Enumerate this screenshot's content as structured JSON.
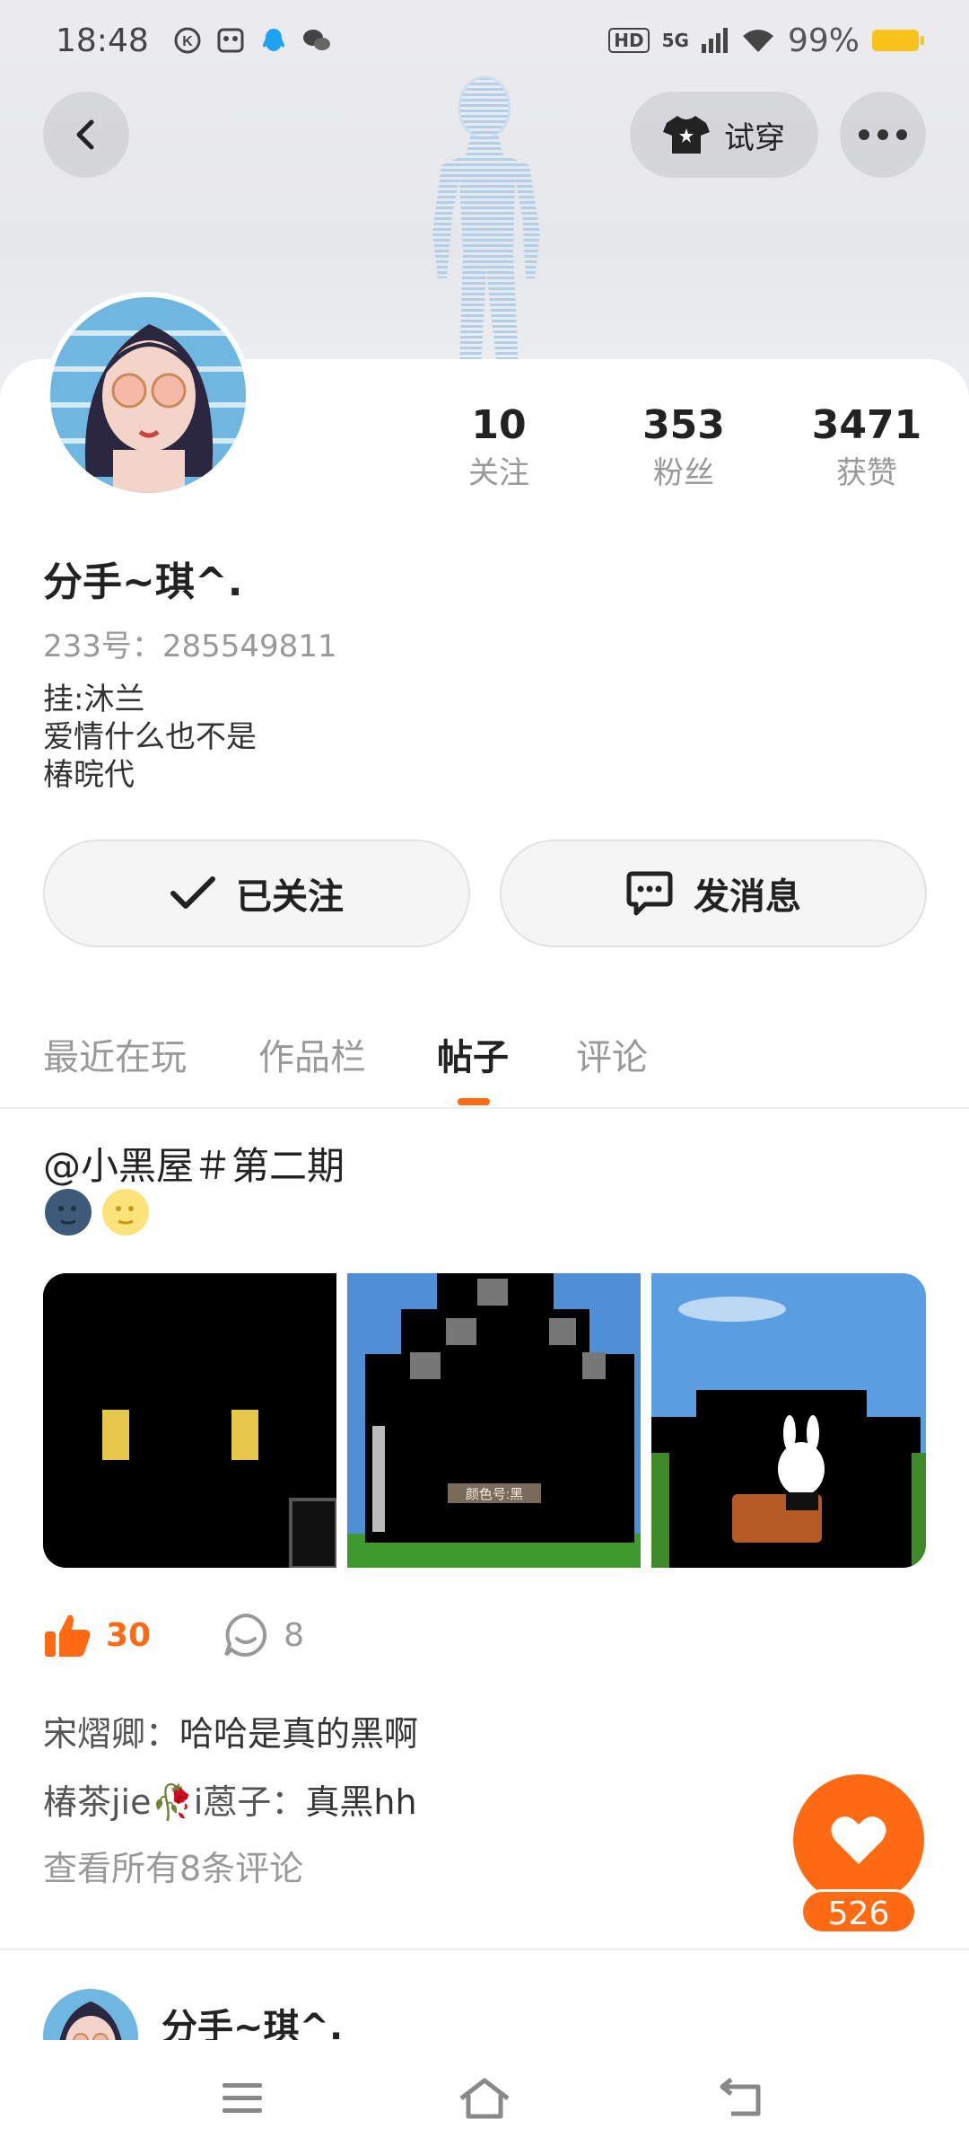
{
  "status_bar": {
    "time": "18:48",
    "network": "5G",
    "battery": "99%"
  },
  "header": {
    "try_on_label": "试穿"
  },
  "profile": {
    "stats": [
      {
        "value": "10",
        "label": "关注"
      },
      {
        "value": "353",
        "label": "粉丝"
      },
      {
        "value": "3471",
        "label": "获赞"
      }
    ],
    "name": "分手~琪^.",
    "uid": "233号：285549811",
    "bio_lines": [
      "挂:沐兰",
      "爱情什么也不是",
      "椿晥代"
    ]
  },
  "buttons": {
    "follow": "已关注",
    "message": "发消息"
  },
  "tabs": [
    {
      "label": "最近在玩",
      "active": false
    },
    {
      "label": "作品栏",
      "active": false
    },
    {
      "label": "帖子",
      "active": true
    },
    {
      "label": "评论",
      "active": false
    }
  ],
  "post": {
    "title": "@小黑屋＃第二期",
    "thumb_sign": "颜色号:黑",
    "likes": "30",
    "comments": "8",
    "comment_list": [
      {
        "author": "宋熠卿",
        "text": "哈哈是真的黑啊"
      },
      {
        "author": "椿茶jie🥀i蒽子",
        "text": "真黑hh"
      }
    ],
    "view_all": "查看所有8条评论"
  },
  "fab": {
    "count": "526"
  },
  "next_post": {
    "name": "分手~琪^."
  },
  "colors": {
    "accent": "#ff6a13",
    "muted": "#999999"
  }
}
